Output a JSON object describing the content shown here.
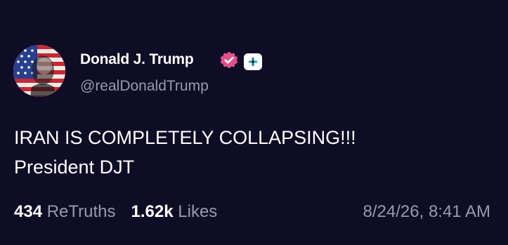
{
  "post": {
    "author": {
      "display_name": "Donald J. Trump",
      "handle": "@realDonaldTrump",
      "verified": true,
      "avatar_icon": "flag-portrait-avatar",
      "badge_icon": "verified-check-icon",
      "extra_icon": "plus-badge-icon"
    },
    "text_lines": [
      "IRAN IS COMPLETELY COLLAPSING!!!",
      "President DJT"
    ],
    "stats": {
      "retruths_count": "434",
      "retruths_label": "ReTruths",
      "likes_count": "1.62k",
      "likes_label": "Likes"
    },
    "timestamp": "8/24/26, 8:41 AM"
  },
  "colors": {
    "background": "#0f0d26",
    "text_primary": "#ffffff",
    "text_secondary": "#9a98ab",
    "verified_badge": "#e2508b"
  }
}
